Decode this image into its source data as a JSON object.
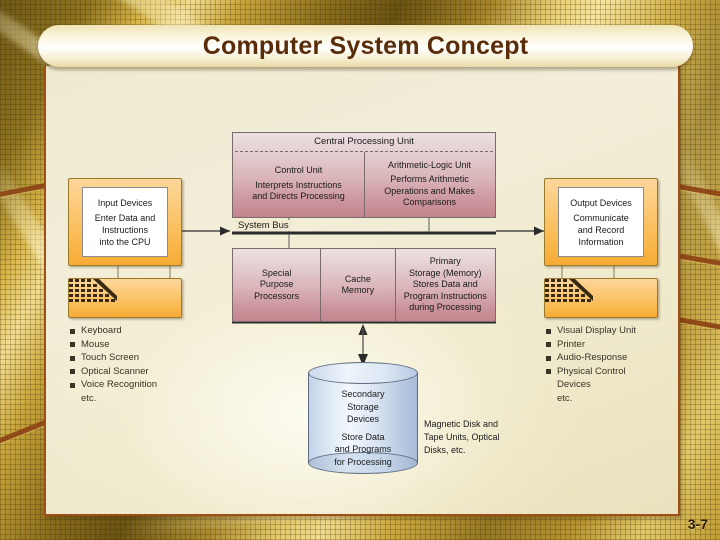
{
  "slide": {
    "title": "Computer System Concept",
    "page_number": "3-7"
  },
  "colors": {
    "title_text": "#5a2d0a",
    "panel_border": "#9c4f17",
    "cpu_block": "#d9b3b8",
    "device_block": "#f9b94f",
    "storage_block": "#c3d3ea",
    "background_gold": "#c9a63c"
  },
  "diagram": {
    "input": {
      "heading": "Input Devices",
      "line1": "Enter Data and",
      "line2": "Instructions",
      "line3": "into the CPU",
      "icon": "keyboard-icon",
      "bullets": [
        "Keyboard",
        "Mouse",
        "Touch Screen",
        "Optical Scanner",
        "Voice Recognition"
      ],
      "etc": "etc."
    },
    "cpu": {
      "heading": "Central Processing Unit",
      "control_unit": {
        "heading": "Control Unit",
        "line1": "Interprets Instructions",
        "line2": "and Directs Processing"
      },
      "alu": {
        "heading": "Arithmetic-Logic Unit",
        "line1": "Performs Arithmetic",
        "line2": "Operations and Makes",
        "line3": "Comparisons"
      }
    },
    "system_bus": "System Bus",
    "middle_row": {
      "special": {
        "line1": "Special",
        "line2": "Purpose",
        "line3": "Processors"
      },
      "cache": {
        "line1": "Cache",
        "line2": "Memory"
      },
      "primary": {
        "line1": "Primary",
        "line2": "Storage (Memory)",
        "line3": "Stores Data and",
        "line4": "Program Instructions",
        "line5": "during Processing"
      }
    },
    "secondary": {
      "line1": "Secondary",
      "line2": "Storage",
      "line3": "Devices",
      "line4": "Store Data",
      "line5": "and Programs",
      "line6": "for Processing",
      "note_line1": "Magnetic Disk and",
      "note_line2": "Tape Units, Optical",
      "note_line3": "Disks, etc."
    },
    "output": {
      "heading": "Output Devices",
      "line1": "Communicate",
      "line2": "and Record",
      "line3": "Information",
      "icon": "keyboard-icon",
      "bullets": [
        "Visual Display Unit",
        "Printer",
        "Audio-Response",
        "Physical Control"
      ],
      "bullet_cont": "Devices",
      "etc": "etc."
    }
  }
}
